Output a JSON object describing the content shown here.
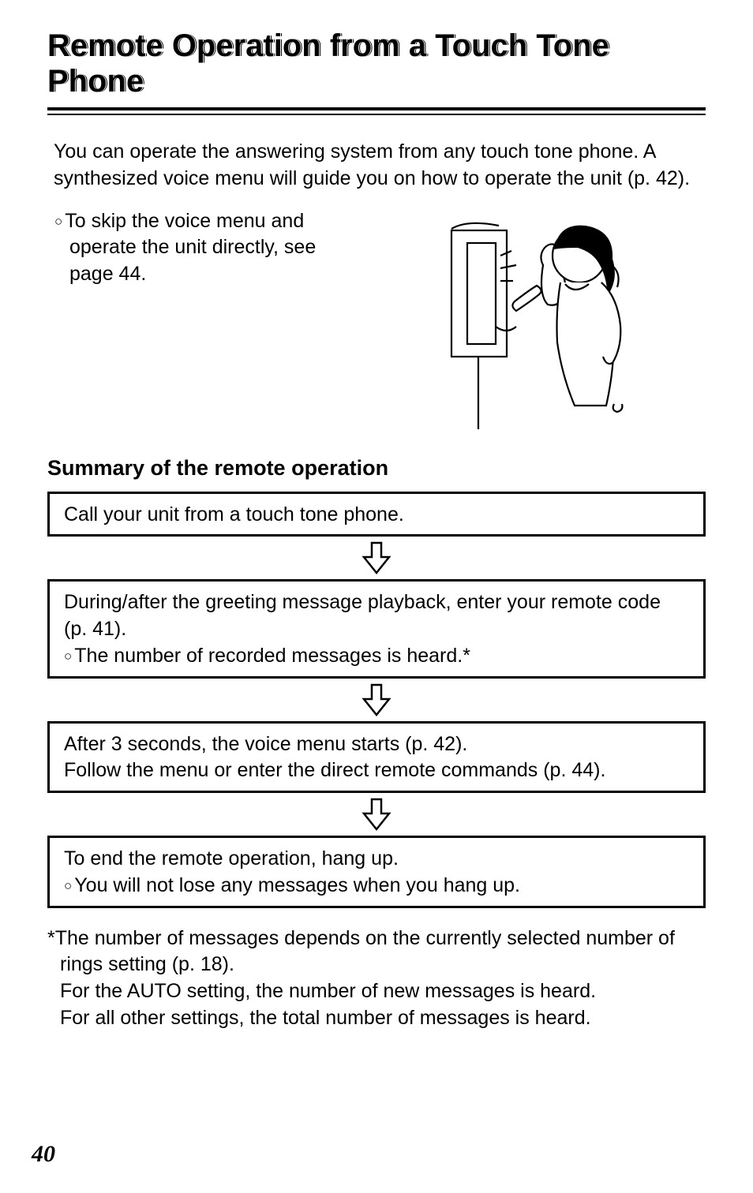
{
  "title": "Remote Operation from a Touch Tone Phone",
  "intro": "You can operate the answering system from any touch tone phone. A synthesized voice menu will guide you on how to operate the unit (p. 42).",
  "skip_note": "To skip the voice menu and operate the unit directly, see page 44.",
  "subhead": "Summary of the remote operation",
  "steps": [
    {
      "lines": [
        "Call your unit from a touch tone phone."
      ],
      "sub": []
    },
    {
      "lines": [
        "During/after the greeting message playback, enter your remote code (p. 41)."
      ],
      "sub": [
        "The number of recorded messages is heard.*"
      ]
    },
    {
      "lines": [
        "After 3 seconds, the voice menu starts (p. 42).",
        "Follow the menu or enter the direct remote commands (p. 44)."
      ],
      "sub": []
    },
    {
      "lines": [
        "To end the remote operation, hang up."
      ],
      "sub": [
        "You will not lose any messages when you hang up."
      ]
    }
  ],
  "footnote_lead": "*The number of messages depends on the currently selected number of rings setting (p. 18).",
  "footnote_line2": "For the AUTO setting, the number of new messages is heard.",
  "footnote_line3": "For all other settings, the total number of messages is heard.",
  "page_number": "40"
}
